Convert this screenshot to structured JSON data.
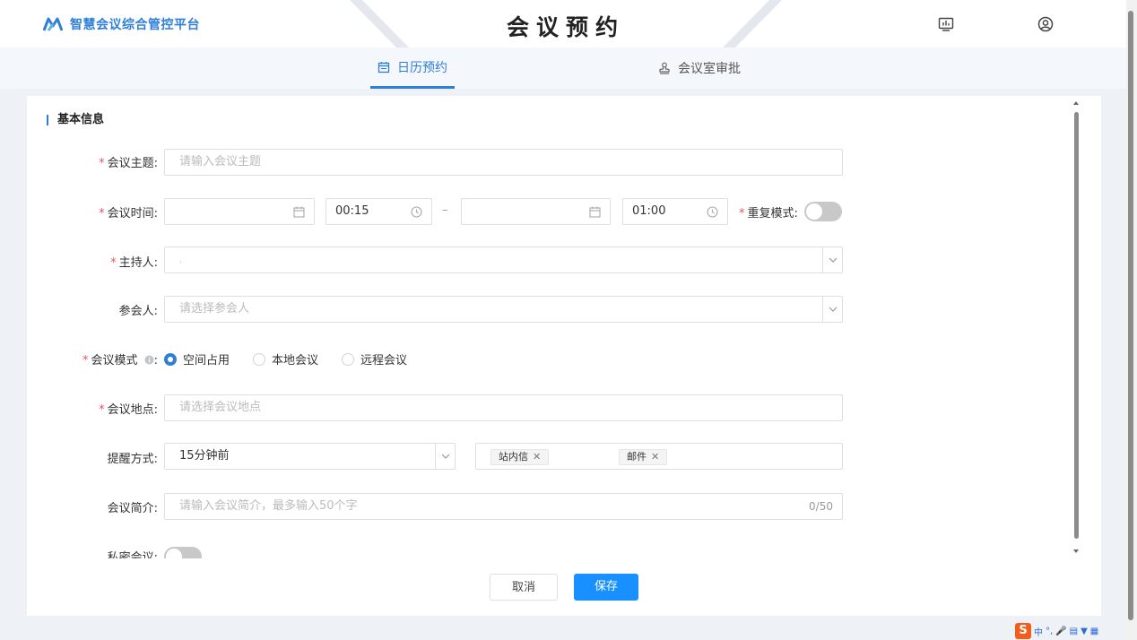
{
  "header": {
    "app_name": "智慧会议综合管控平台",
    "page_title": "会议预约",
    "icons": [
      "monitor-chart-icon",
      "user-circle-icon"
    ]
  },
  "tabs": [
    {
      "label": "日历预约",
      "icon": "calendar-icon",
      "active": true
    },
    {
      "label": "会议室审批",
      "icon": "stamp-icon",
      "active": false
    }
  ],
  "form": {
    "section_title": "基本信息",
    "subject": {
      "label": "会议主题:",
      "required": true,
      "placeholder": "请输入会议主题",
      "value": ""
    },
    "time": {
      "label": "会议时间:",
      "required": true,
      "start_date": "",
      "start_time": "00:15",
      "separator": "–",
      "end_date": "",
      "end_time": "01:00"
    },
    "repeat": {
      "label": "重复模式:",
      "required": true,
      "on": false
    },
    "host": {
      "label": "主持人:",
      "required": true,
      "value": "."
    },
    "attendees": {
      "label": "参会人:",
      "required": false,
      "placeholder": "请选择参会人"
    },
    "mode": {
      "label": "会议模式",
      "colon": ":",
      "required": true,
      "options": [
        "空间占用",
        "本地会议",
        "远程会议"
      ],
      "selected": "空间占用"
    },
    "location": {
      "label": "会议地点:",
      "required": true,
      "placeholder": "请选择会议地点"
    },
    "reminder": {
      "label": "提醒方式:",
      "time_value": "15分钟前",
      "channels": [
        "站内信",
        "邮件"
      ]
    },
    "intro": {
      "label": "会议简介:",
      "placeholder": "请输入会议简介，最多输入50个字",
      "counter": "0/50"
    },
    "private": {
      "label": "私密会议:",
      "on": false
    }
  },
  "actions": {
    "cancel": "取消",
    "save": "保存"
  },
  "colors": {
    "primary": "#2f7fd9",
    "save_button": "#1890ff",
    "required": "#ee5555"
  },
  "taskbar": {
    "ime_logo": "S",
    "ime_mode": "中"
  }
}
